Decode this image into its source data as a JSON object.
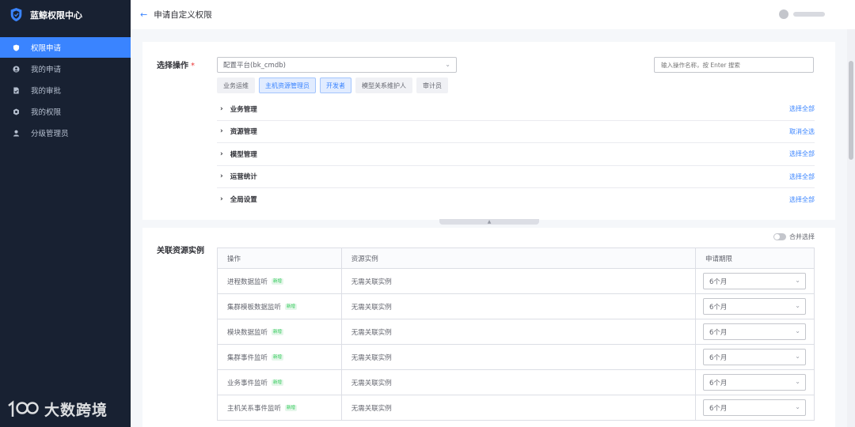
{
  "app": {
    "title": "蓝鲸权限中心"
  },
  "sidebar": {
    "items": [
      {
        "label": "权限申请",
        "icon": "shield-icon",
        "active": true
      },
      {
        "label": "我的申请",
        "icon": "user-circle-icon",
        "active": false
      },
      {
        "label": "我的审批",
        "icon": "document-check-icon",
        "active": false
      },
      {
        "label": "我的权限",
        "icon": "badge-icon",
        "active": false
      },
      {
        "label": "分级管理员",
        "icon": "person-icon",
        "active": false
      }
    ]
  },
  "watermark": {
    "text": "大数跨境"
  },
  "header": {
    "back_icon": "←",
    "title": "申请自定义权限"
  },
  "operation": {
    "label": "选择操作",
    "required_mark": "*",
    "system_select": "配置平台(bk_cmdb)",
    "search_placeholder": "输入操作名称，按 Enter 搜索",
    "templates": [
      {
        "label": "业务运维",
        "selected": false
      },
      {
        "label": "主机资源管理员",
        "selected": true
      },
      {
        "label": "开发者",
        "selected": true
      },
      {
        "label": "模型关系维护人",
        "selected": false
      },
      {
        "label": "审计员",
        "selected": false
      }
    ],
    "groups": [
      {
        "name": "业务管理",
        "action": "选择全部"
      },
      {
        "name": "资源管理",
        "action": "取消全选"
      },
      {
        "name": "模型管理",
        "action": "选择全部"
      },
      {
        "name": "运营统计",
        "action": "选择全部"
      },
      {
        "name": "全局设置",
        "action": "选择全部"
      }
    ]
  },
  "resources": {
    "label": "关联资源实例",
    "merge_label": "合并选择",
    "merge_on": false,
    "columns": {
      "operation": "操作",
      "instance": "资源实例",
      "term": "申请期限"
    },
    "new_badge": "新增",
    "rows": [
      {
        "operation": "进程数据监听",
        "instance": "无需关联实例",
        "term": "6个月"
      },
      {
        "operation": "集群模板数据监听",
        "instance": "无需关联实例",
        "term": "6个月"
      },
      {
        "operation": "模块数据监听",
        "instance": "无需关联实例",
        "term": "6个月"
      },
      {
        "operation": "集群事件监听",
        "instance": "无需关联实例",
        "term": "6个月"
      },
      {
        "operation": "业务事件监听",
        "instance": "无需关联实例",
        "term": "6个月"
      },
      {
        "operation": "主机关系事件监听",
        "instance": "无需关联实例",
        "term": "6个月"
      }
    ]
  },
  "colors": {
    "accent": "#3a84ff",
    "sidebar_bg": "#182132",
    "new_badge": "#2dcb56"
  }
}
